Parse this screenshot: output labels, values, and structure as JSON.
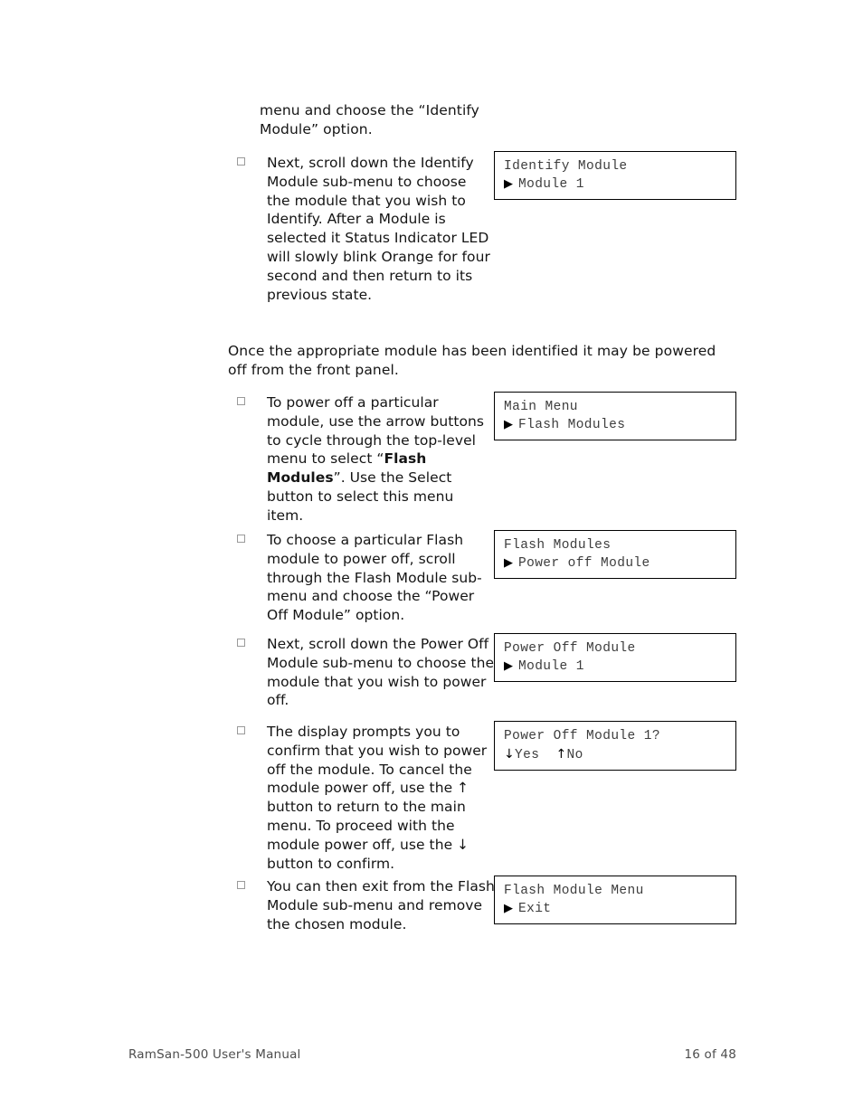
{
  "document": {
    "title": "RamSan-500 User's Manual",
    "page_label": "16 of 48"
  },
  "content": {
    "continued_paragraph": "menu and choose the “Identify Module” option.",
    "section_intro": "Once the appropriate module has been identified it may be powered off from the front panel.",
    "bullets": [
      {
        "id": "identify-module",
        "text": "Next, scroll down the Identify Module sub-menu to choose the module that you wish to Identify.  After a Module is selected it Status Indicator LED will slowly blink Orange for four second and then return to its previous state."
      },
      {
        "id": "power-off-particular",
        "text_before_bold": "To power off a particular module, use the arrow buttons to cycle through the top-level menu to select “",
        "bold": "Flash Modules",
        "text_after_bold": "”. Use the Select button to select this menu item."
      },
      {
        "id": "choose-flash-module",
        "text": "To choose a particular Flash module to power off, scroll through the Flash Module sub-menu and choose the “Power Off Module” option."
      },
      {
        "id": "scroll-power-off",
        "text": "Next, scroll down the Power Off Module sub-menu to choose the module that you wish to power off."
      },
      {
        "id": "confirm-prompt",
        "text": "The display prompts you to confirm that you wish to power off the module. To cancel the module power off, use the ↑ button to return to the main menu. To proceed with the module power off, use the ↓ button to confirm."
      },
      {
        "id": "exit-submenu",
        "text": "You can then exit from the Flash Module sub-menu and remove the chosen module."
      }
    ]
  },
  "lcd_displays": [
    {
      "id": "identify-module-display",
      "line1": "Identify Module",
      "caret": "▶",
      "line2": "Module 1"
    },
    {
      "id": "main-menu-display",
      "line1": "Main Menu",
      "caret": "▶",
      "line2": "Flash Modules"
    },
    {
      "id": "flash-modules-display",
      "line1": "Flash Modules",
      "caret": "▶",
      "line2": "Power off Module"
    },
    {
      "id": "power-off-module-display",
      "line1": "Power Off Module",
      "caret": "▶",
      "line2": "Module 1"
    },
    {
      "id": "confirm-display",
      "line1": "Power Off Module 1?",
      "down_arrow": "↓",
      "yes_label": "Yes",
      "up_arrow": "↑",
      "no_label": "No"
    },
    {
      "id": "flash-module-menu-display",
      "line1": "Flash Module Menu",
      "caret": "▶",
      "line2": "Exit"
    }
  ],
  "icons": {
    "bullet": "empty-square-bullet",
    "caret": "right-triangle-caret"
  }
}
